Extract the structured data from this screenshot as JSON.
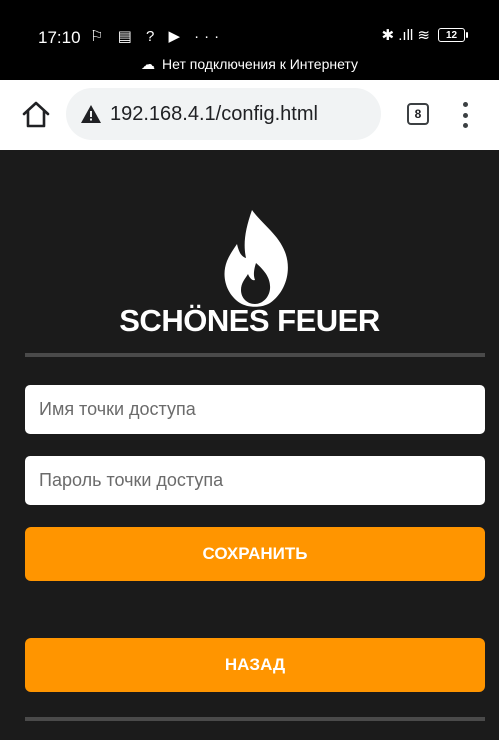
{
  "status_bar": {
    "time": "17:10",
    "left_icons": "⚐ ▤ ? ▶ ···",
    "right_icons": "✱ .ıll ≋",
    "battery": "12",
    "network_notice": "Нет подключения к Интернету"
  },
  "browser": {
    "url": "192.168.4.1/config.html",
    "tab_count": "8",
    "warning_color": "#202124"
  },
  "page": {
    "brand": "SCHÖNES FEUER",
    "ssid_placeholder": "Имя точки доступа",
    "password_placeholder": "Пароль точки доступа",
    "save_label": "СОХРАНИТЬ",
    "back_label": "НАЗАД",
    "accent_color": "#ff9500",
    "background_color": "#1b1b1b"
  }
}
